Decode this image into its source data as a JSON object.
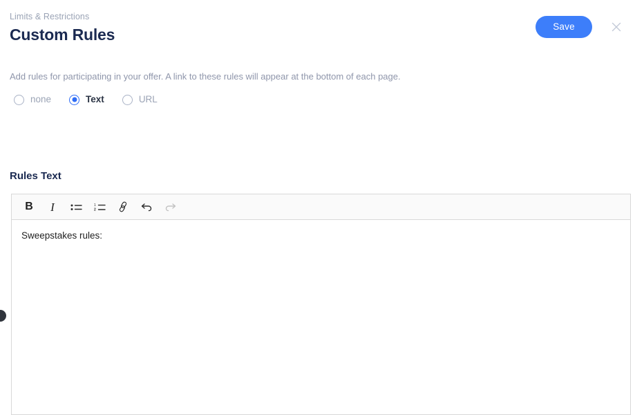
{
  "header": {
    "breadcrumb": "Limits & Restrictions",
    "title": "Custom Rules",
    "save_label": "Save",
    "close_icon": "close-icon"
  },
  "description": "Add rules for participating in your offer. A link to these rules will appear at the bottom of each page.",
  "rule_type": {
    "selected": "Text",
    "options": [
      {
        "label": "none",
        "selected": false
      },
      {
        "label": "Text",
        "selected": true
      },
      {
        "label": "URL",
        "selected": false
      }
    ]
  },
  "rules_text": {
    "label": "Rules Text",
    "content": "Sweepstakes rules:",
    "toolbar": [
      {
        "name": "bold-icon",
        "label": "B",
        "disabled": false
      },
      {
        "name": "italic-icon",
        "label": "I",
        "disabled": false
      },
      {
        "name": "bullet-list-icon",
        "label": "",
        "disabled": false
      },
      {
        "name": "numbered-list-icon",
        "label": "",
        "disabled": false
      },
      {
        "name": "link-icon",
        "label": "",
        "disabled": false
      },
      {
        "name": "undo-icon",
        "label": "",
        "disabled": false
      },
      {
        "name": "redo-icon",
        "label": "",
        "disabled": true
      }
    ]
  },
  "colors": {
    "accent_blue": "#3d7efa",
    "title_navy": "#1b2a51",
    "muted_text": "#8f96ab",
    "editor_border": "#d8d8d8",
    "toolbar_bg": "#fafafa",
    "handle_dark": "#30343c"
  }
}
